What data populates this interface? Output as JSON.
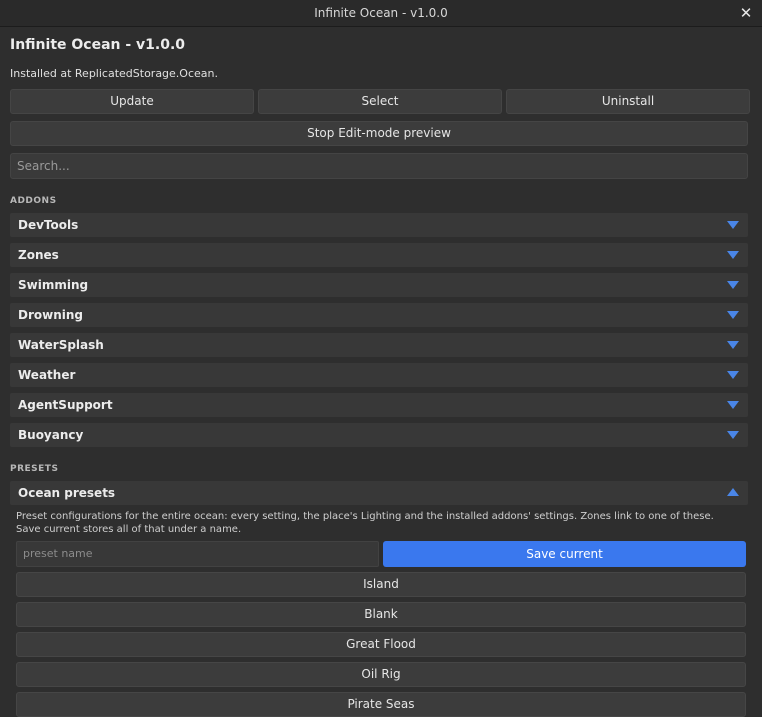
{
  "window": {
    "title": "Infinite Ocean - v1.0.0",
    "close_glyph": "✕"
  },
  "header": {
    "title": "Infinite Ocean - v1.0.0",
    "install_text": "Installed at ReplicatedStorage.Ocean."
  },
  "actions": {
    "update": "Update",
    "select": "Select",
    "uninstall": "Uninstall",
    "stop_preview": "Stop Edit-mode preview"
  },
  "search": {
    "placeholder": "Search..."
  },
  "addons": {
    "heading": "ADDONS",
    "items": [
      {
        "label": "DevTools"
      },
      {
        "label": "Zones"
      },
      {
        "label": "Swimming"
      },
      {
        "label": "Drowning"
      },
      {
        "label": "WaterSplash"
      },
      {
        "label": "Weather"
      },
      {
        "label": "AgentSupport"
      },
      {
        "label": "Buoyancy"
      }
    ]
  },
  "presets": {
    "heading": "PRESETS",
    "group_label": "Ocean presets",
    "description": "Preset configurations for the entire ocean: every setting, the place's Lighting and the installed addons' settings. Zones link to one of these. Save current stores all of that under a name.",
    "name_placeholder": "preset name",
    "save_label": "Save current",
    "items": [
      {
        "label": "Island"
      },
      {
        "label": "Blank"
      },
      {
        "label": "Great Flood"
      },
      {
        "label": "Oil Rig"
      },
      {
        "label": "Pirate Seas"
      }
    ]
  },
  "colors": {
    "accent": "#3a78ee",
    "caret": "#4a86e8",
    "background": "#2e2e2e"
  }
}
